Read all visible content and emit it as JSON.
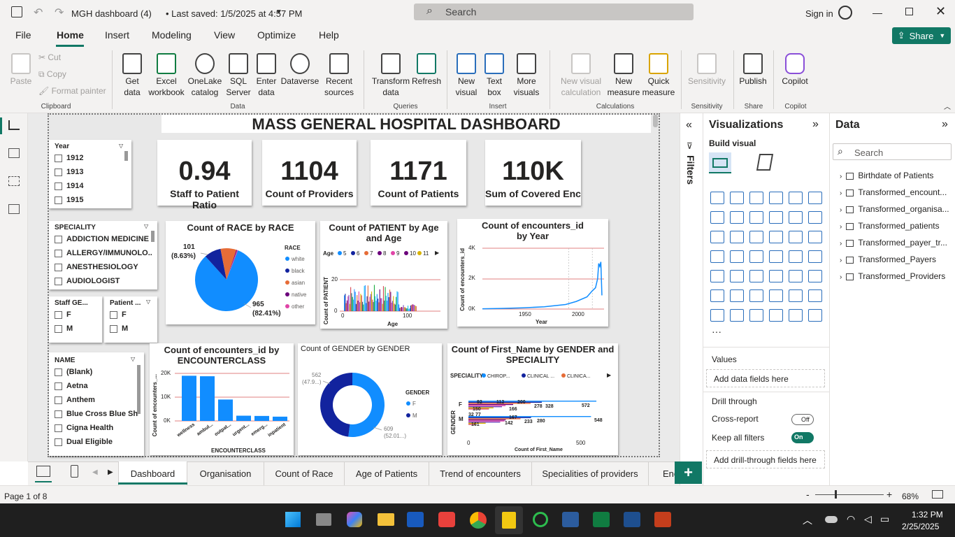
{
  "titlebar": {
    "doc_title": "MGH dashboard (4)",
    "saved": "• Last saved: 1/5/2025 at 4:57 PM",
    "search": "Search",
    "signin": "Sign in"
  },
  "menu": {
    "items": [
      "File",
      "Home",
      "Insert",
      "Modeling",
      "View",
      "Optimize",
      "Help"
    ],
    "share": "Share"
  },
  "ribbon": {
    "clipboard": {
      "paste": "Paste",
      "cut": "Cut",
      "copy": "Copy",
      "format_painter": "Format painter",
      "group": "Clipboard"
    },
    "data": {
      "get_data": "Get data",
      "excel": "Excel workbook",
      "onelake": "OneLake catalog",
      "sql": "SQL Server",
      "enter": "Enter data",
      "dataverse": "Dataverse",
      "recent": "Recent sources",
      "group": "Data"
    },
    "queries": {
      "transform": "Transform data",
      "refresh": "Refresh",
      "group": "Queries"
    },
    "insert": {
      "new_visual": "New visual",
      "text_box": "Text box",
      "more_visuals": "More visuals",
      "group": "Insert"
    },
    "calculations": {
      "new_visual_calc": "New visual calculation",
      "new_measure": "New measure",
      "quick_measure": "Quick measure",
      "group": "Calculations"
    },
    "sensitivity": {
      "label": "Sensitivity",
      "group": "Sensitivity"
    },
    "share": {
      "publish": "Publish",
      "group": "Share"
    },
    "copilot": {
      "label": "Copilot",
      "group": "Copilot"
    }
  },
  "dashboard": {
    "title": "MASS GENERAL HOSPITAL DASHBOARD",
    "kpis": [
      {
        "value": "0.94",
        "label": "Staff to Patient Ratio"
      },
      {
        "value": "1104",
        "label": "Count of Providers"
      },
      {
        "value": "1171",
        "label": "Count of Patients"
      },
      {
        "value": "110K",
        "label": "Sum of Covered Enc"
      }
    ],
    "year_slicer": {
      "header": "Year",
      "items": [
        "1912",
        "1913",
        "1914",
        "1915"
      ]
    },
    "speciality_slicer": {
      "header": "SPECIALITY",
      "items": [
        "ADDICTION MEDICINE",
        "ALLERGY/IMMUNOLO...",
        "ANESTHESIOLOGY",
        "AUDIOLOGIST"
      ]
    },
    "staff_gender_slicer": {
      "header": "Staff GE...",
      "items": [
        "F",
        "M"
      ]
    },
    "patient_gender_slicer": {
      "header": "Patient ...",
      "items": [
        "F",
        "M"
      ]
    },
    "name_slicer": {
      "header": "NAME",
      "items": [
        "(Blank)",
        "Aetna",
        "Anthem",
        "Blue Cross Blue Shi...",
        "Cigna Health",
        "Dual Eligible"
      ]
    },
    "race_chart": {
      "title": "Count of RACE by RACE",
      "legend_title": "RACE",
      "legend": [
        "white",
        "black",
        "asian",
        "native",
        "other"
      ],
      "label_small_value": "101",
      "label_small_pct": "(8.63%)",
      "label_big_value": "965",
      "label_big_pct": "(82.41%)"
    },
    "age_chart": {
      "title": "Count of PATIENT by Age and Age",
      "legend_title": "Age",
      "legend": [
        "5",
        "6",
        "7",
        "8",
        "9",
        "10",
        "11"
      ],
      "ylabel": "Count of PATIENT",
      "xlabel": "Age",
      "yticks": [
        "20",
        "0"
      ],
      "xticks": [
        "0",
        "100"
      ]
    },
    "enc_year_chart": {
      "title": "Count of encounters_id by Year",
      "ylabel": "Count of encounters_id",
      "xlabel": "Year",
      "yticks": [
        "4K",
        "2K",
        "0K"
      ],
      "xticks": [
        "1950",
        "2000"
      ]
    },
    "enc_class_chart": {
      "title": "Count of encounters_id by ENCOUNTERCLASS",
      "ylabel": "Count of encounters_...",
      "xlabel": "ENCOUNTERCLASS",
      "yticks": [
        "20K",
        "10K",
        "0K"
      ],
      "categories": [
        "wellness",
        "ambul...",
        "outpat...",
        "urgent...",
        "emerg...",
        "inpatient"
      ]
    },
    "gender_chart": {
      "title": "Count of GENDER by GENDER",
      "legend_title": "GENDER",
      "legend": [
        "F",
        "M"
      ],
      "label_m_value": "562",
      "label_m_pct": "(47.9...)",
      "label_f_value": "609",
      "label_f_pct": "(52.01...)"
    },
    "firstname_chart": {
      "title": "Count of First_Name by GENDER and SPECIALITY",
      "legend_title": "SPECIALITY",
      "legend": [
        "CHIROP...",
        "CLINICAL ...",
        "CLINICA..."
      ],
      "ylabel": "GENDER",
      "xlabel": "Count of First_Name",
      "categories": [
        "F",
        "M"
      ],
      "f_labels": [
        "112",
        "200",
        "166",
        "278",
        "328",
        "572",
        "92",
        "150"
      ],
      "m_labels": [
        "167",
        "77",
        "32",
        "161",
        "142",
        "233",
        "280",
        "548"
      ],
      "xticks": [
        "0",
        "500"
      ]
    }
  },
  "chart_data": [
    {
      "type": "pie",
      "title": "Count of RACE by RACE",
      "categories": [
        "white",
        "black",
        "asian",
        "native",
        "other"
      ],
      "values": [
        965,
        101,
        95,
        5,
        5
      ]
    },
    {
      "type": "bar",
      "title": "Count of encounters_id by ENCOUNTERCLASS",
      "categories": [
        "wellness",
        "ambul...",
        "outpat...",
        "urgent...",
        "emerg...",
        "inpatient"
      ],
      "values": [
        19000,
        18800,
        9000,
        2200,
        2100,
        1800
      ],
      "ylim": [
        0,
        20000
      ]
    },
    {
      "type": "pie",
      "title": "Count of GENDER by GENDER",
      "categories": [
        "F",
        "M"
      ],
      "values": [
        609,
        562
      ]
    },
    {
      "type": "line",
      "title": "Count of encounters_id by Year",
      "xlabel": "Year",
      "ylabel": "Count of encounters_id",
      "x": [
        1912,
        1930,
        1950,
        1970,
        1990,
        2000,
        2010,
        2015,
        2018,
        2020,
        2021,
        2022,
        2023,
        2024
      ],
      "y": [
        20,
        40,
        80,
        150,
        300,
        500,
        800,
        1200,
        1400,
        2000,
        3000,
        2800,
        3100,
        900
      ],
      "ylim": [
        0,
        4000
      ]
    }
  ],
  "panes": {
    "filters": "Filters",
    "viz_title": "Visualizations",
    "build_visual": "Build visual",
    "values": "Values",
    "add_data": "Add data fields here",
    "drill": "Drill through",
    "cross_report": "Cross-report",
    "cross_state": "Off",
    "keep_filters": "Keep all filters",
    "keep_state": "On",
    "add_drill": "Add drill-through fields here",
    "data_title": "Data",
    "data_search": "Search",
    "tables": [
      "Birthdate of Patients",
      "Transformed_encount...",
      "Transformed_organisa...",
      "Transformed_patients",
      "Transformed_payer_tr...",
      "Transformed_Payers",
      "Transformed_Providers"
    ]
  },
  "pages": [
    "Dashboard",
    "Organisation",
    "Count of Race",
    "Age of Patients",
    "Trend of encounters",
    "Specialities of providers",
    "Enc"
  ],
  "status": {
    "page": "Page 1 of 8",
    "zoom": "68%"
  },
  "taskbar": {
    "time": "1:32 PM",
    "date": "2/25/2025"
  },
  "colors": {
    "accent": "#117865",
    "blue": "#118dff",
    "navy": "#12239e",
    "orange": "#e66c37",
    "purple": "#6b007b",
    "pink": "#e044a7"
  }
}
